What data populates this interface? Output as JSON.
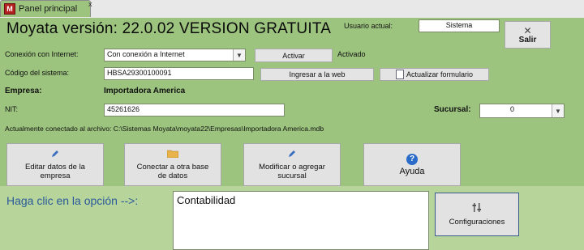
{
  "tab": {
    "icon": "M",
    "label": "Panel principal",
    "close": "x"
  },
  "title": "Moyata versión: 22.0.02 VERSION GRATUITA",
  "user": {
    "label": "Usuario actual:",
    "value": "Sistema"
  },
  "exit_button": {
    "icon": "close-icon",
    "label": "Salir"
  },
  "connection": {
    "label": "Conexión con Internet:",
    "value": "Con conexión a Internet",
    "activate_label": "Activar",
    "status": "Activado"
  },
  "system_code": {
    "label": "Código del sistema:",
    "value": "HBSA29300100091"
  },
  "web_button": "Ingresar a la web",
  "update_form_button": "Actualizar formulario",
  "company": {
    "label": "Empresa:",
    "value": "Importadora America"
  },
  "nit": {
    "label": "NIT:",
    "value": "45261626"
  },
  "branch": {
    "label": "Sucursal:",
    "value": "0"
  },
  "connected_file": "Actualmente conectado al archivo: C:\\Sistemas Moyata\\moyata22\\Empresas\\Importadora America.mdb",
  "actions": {
    "edit_company": {
      "line1": "Editar datos de la",
      "line2": "empresa",
      "icon": "pencil-icon"
    },
    "connect_db": {
      "line1": "Conectar a otra base",
      "line2": "de datos",
      "icon": "folder-icon"
    },
    "edit_branch": {
      "line1": "Modificar o agregar",
      "line2": "sucursal",
      "icon": "pencil-icon"
    },
    "help": {
      "label": "Ayuda",
      "icon": "help-icon"
    }
  },
  "option_prompt": "Haga clic en la opción -->:",
  "option_list": [
    "Contabilidad"
  ],
  "settings_button": {
    "label": "Configuraciones",
    "icon": "settings-icon"
  },
  "colors": {
    "background": "#9cc47e",
    "lower": "#b7d49b",
    "help_icon": "#2a6ac8"
  }
}
